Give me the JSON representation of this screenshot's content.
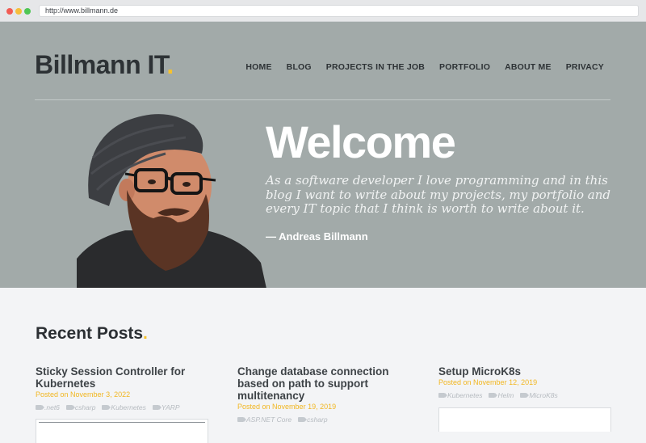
{
  "browser": {
    "url": "http://www.billmann.de"
  },
  "header": {
    "logo_text": "Billmann IT",
    "logo_dot": ".",
    "nav": [
      {
        "label": "HOME"
      },
      {
        "label": "BLOG"
      },
      {
        "label": "PROJECTS IN THE JOB"
      },
      {
        "label": "PORTFOLIO"
      },
      {
        "label": "ABOUT ME"
      },
      {
        "label": "PRIVACY"
      }
    ]
  },
  "hero": {
    "title": "Welcome",
    "intro": "As a software developer I love programming and in this blog I want to write about my projects, my portfolio and every IT topic that I think is worth to write about it.",
    "author": "— Andreas Billmann"
  },
  "recent_posts": {
    "title": "Recent Posts",
    "title_dot": ".",
    "date_prefix": "Posted on",
    "posts": [
      {
        "title": "Sticky Session Controller for Kubernetes",
        "date": "November 3, 2022",
        "tags": [
          ".net6",
          "csharp",
          "Kubernetes",
          "YARP"
        ]
      },
      {
        "title": "Change database connection based on path to support multitenancy",
        "date": "November 19, 2019",
        "tags": [
          "ASP.NET Core",
          "csharp"
        ]
      },
      {
        "title": "Setup MicroK8s",
        "date": "November 12, 2019",
        "tags": [
          "Kubernetes",
          "Helm",
          "MicroK8s"
        ]
      }
    ]
  },
  "colors": {
    "hero_background": "#a2aaa9",
    "accent": "#f7c22c",
    "page_background": "#f3f4f6"
  },
  "icons": [
    "tag-icon",
    "portrait-illustration"
  ]
}
